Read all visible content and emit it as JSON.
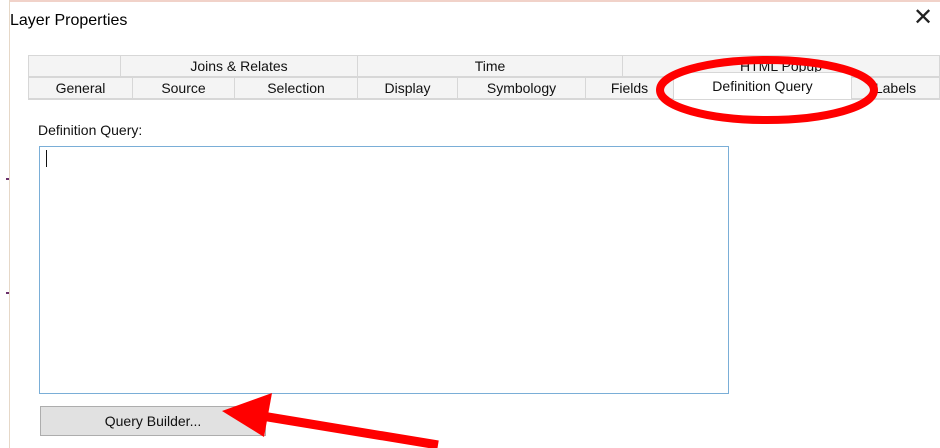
{
  "window": {
    "title": "Layer Properties",
    "close_glyph": "✕"
  },
  "tabs": {
    "back_row": [
      {
        "label": ""
      },
      {
        "label": "Joins & Relates"
      },
      {
        "label": "Time"
      },
      {
        "label": "HTML Popup"
      }
    ],
    "front_row": [
      {
        "label": "General"
      },
      {
        "label": "Source"
      },
      {
        "label": "Selection"
      },
      {
        "label": "Display"
      },
      {
        "label": "Symbology"
      },
      {
        "label": "Fields"
      },
      {
        "label": "Definition Query",
        "active": true
      },
      {
        "label": "Labels"
      }
    ]
  },
  "panel": {
    "definition_query_label": "Definition Query:",
    "query_value": "",
    "query_builder_label": "Query Builder..."
  },
  "annotations": {
    "highlight_color": "#ff0000",
    "highlighted_tab": "Definition Query",
    "arrow_target": "Query Builder..."
  },
  "colors": {
    "input_border": "#7aaed7",
    "button_bg": "#e1e1e1",
    "tab_bg": "#f4f4f4"
  }
}
